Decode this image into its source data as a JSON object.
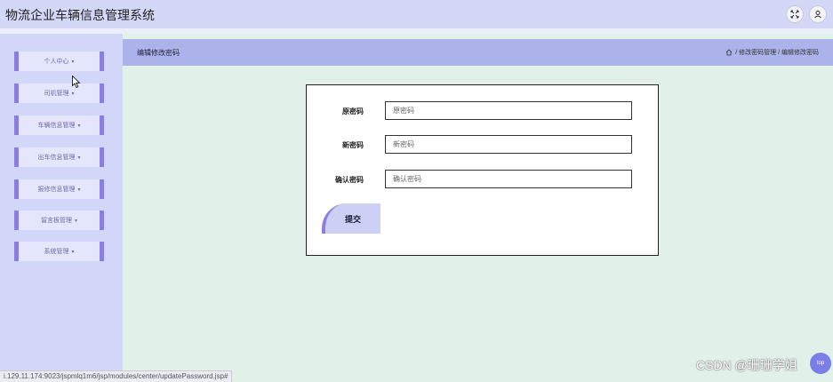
{
  "app": {
    "title": "物流企业车辆信息管理系统",
    "icons": [
      "fullscreen-icon",
      "user-icon"
    ]
  },
  "sidebar": {
    "items": [
      {
        "label": "个人中心"
      },
      {
        "label": "司机管理"
      },
      {
        "label": "车辆信息管理"
      },
      {
        "label": "出车信息管理"
      },
      {
        "label": "报修信息管理"
      },
      {
        "label": "留言板管理"
      },
      {
        "label": "系统管理"
      }
    ]
  },
  "page": {
    "title": "编辑修改密码",
    "breadcrumb": "/ 修改密码管理 / 编辑修改密码"
  },
  "form": {
    "old_password": {
      "label": "原密码",
      "placeholder": "原密码",
      "value": ""
    },
    "new_password": {
      "label": "新密码",
      "placeholder": "新密码",
      "value": ""
    },
    "confirm_password": {
      "label": "确认密码",
      "placeholder": "确认密码",
      "value": ""
    },
    "submit_label": "提交"
  },
  "status_bar": {
    "url": "i.129.11.174:9023/jspmlq1m6/jsp/modules/center/updatePassword.jsp#"
  },
  "watermark": "CSDN @珊珊学姐",
  "fab_label": "top",
  "colors": {
    "topbar": "#d4d8f7",
    "sidebar": "#d2d6f8",
    "nav_accent": "#8a7fe0",
    "header": "#abb3ea",
    "content_bg": "#e2f0ea"
  }
}
